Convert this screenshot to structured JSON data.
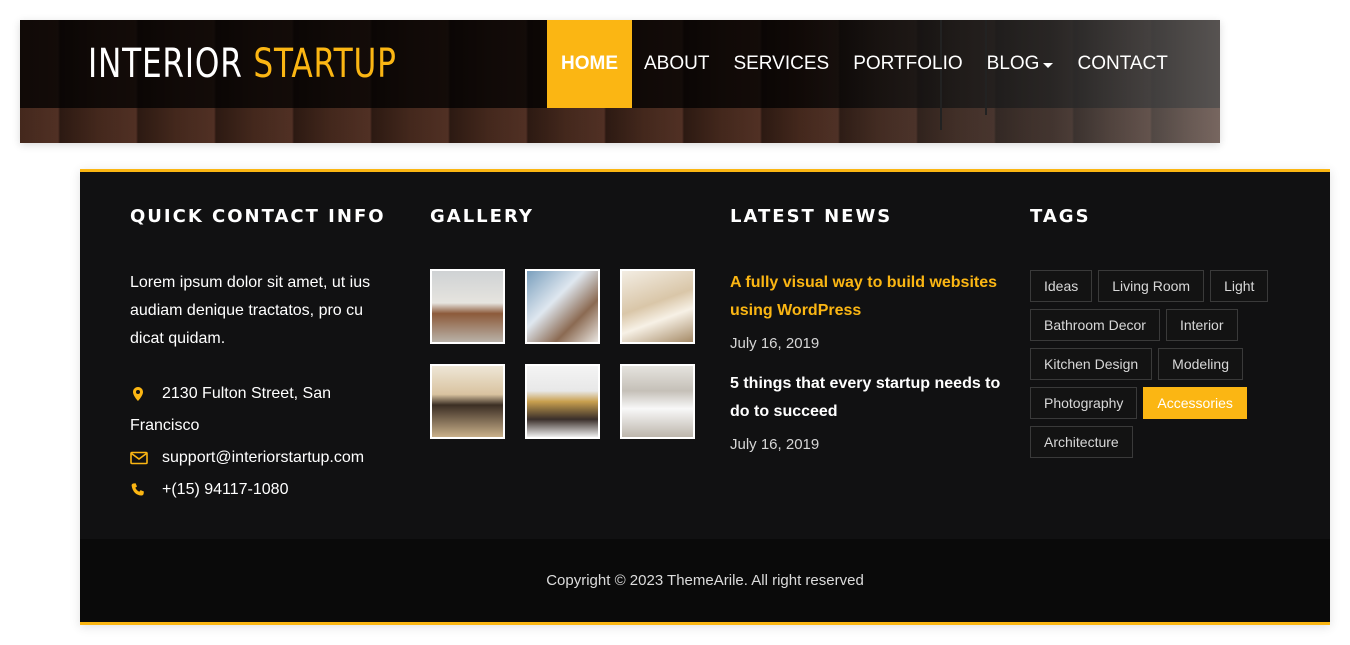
{
  "header": {
    "logo": {
      "part1": "INTERIOR",
      "part2": "STARTUP"
    },
    "nav": [
      {
        "label": "HOME",
        "active": true
      },
      {
        "label": "ABOUT"
      },
      {
        "label": "SERVICES"
      },
      {
        "label": "PORTFOLIO"
      },
      {
        "label": "BLOG",
        "has_dropdown": true
      },
      {
        "label": "CONTACT"
      }
    ]
  },
  "footer": {
    "contact": {
      "heading": "QUICK CONTACT INFO",
      "about": "Lorem ipsum dolor sit amet, ut ius audiam denique tractatos, pro cu dicat quidam.",
      "address": "2130 Fulton Street, San Francisco",
      "email": "support@interiorstartup.com",
      "phone": "+(15) 94117-1080"
    },
    "gallery": {
      "heading": "GALLERY",
      "images": [
        "office-room",
        "kitchen",
        "living-room",
        "bedroom-suite",
        "bedroom",
        "dining-room"
      ]
    },
    "news": {
      "heading": "LATEST NEWS",
      "items": [
        {
          "title": "A fully visual way to build websites using WordPress",
          "date": "July 16, 2019"
        },
        {
          "title": "5 things that every startup needs to do to succeed",
          "date": "July 16, 2019"
        }
      ]
    },
    "tags": {
      "heading": "TAGS",
      "items": [
        "Ideas",
        "Living Room",
        "Light",
        "Bathroom Decor",
        "Interior",
        "Kitchen Design",
        "Modeling",
        "Photography",
        "Accessories",
        "Architecture"
      ],
      "active": "Accessories"
    },
    "copyright": "Copyright © 2023 ThemeArile. All right reserved"
  },
  "colors": {
    "accent": "#fbb613",
    "footer_bg": "#111112",
    "copyright_bg": "#0a0a0a"
  }
}
